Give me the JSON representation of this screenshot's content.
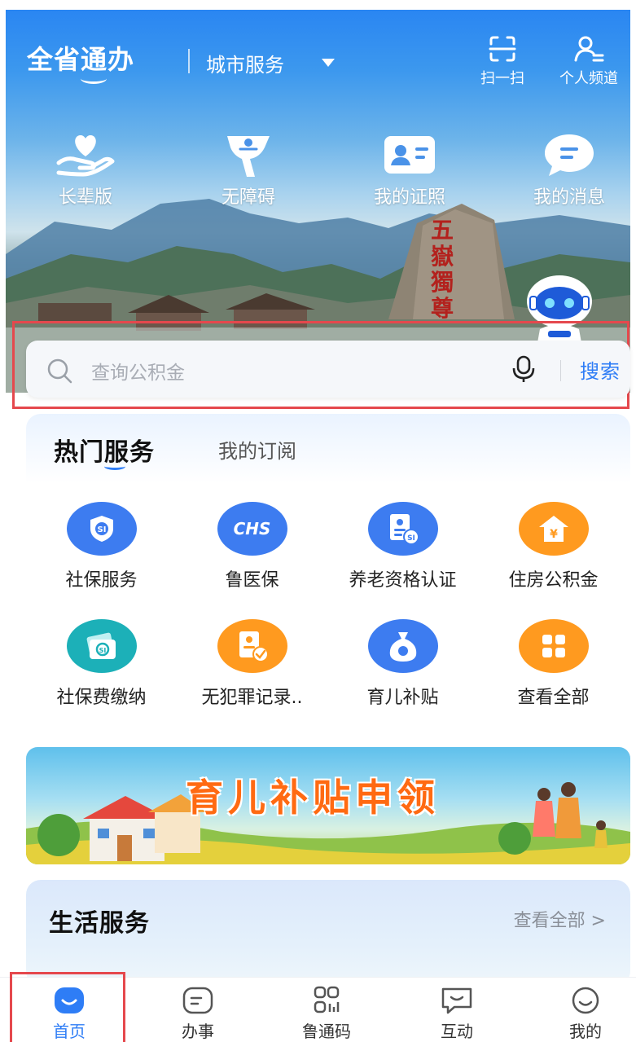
{
  "header": {
    "brand": "全省通办",
    "city_selector": "城市服务",
    "scan_label": "扫一扫",
    "personal_label": "个人频道"
  },
  "quick_actions": [
    {
      "label": "长辈版",
      "icon": "heart-hand-icon"
    },
    {
      "label": "无障碍",
      "icon": "accessibility-icon"
    },
    {
      "label": "我的证照",
      "icon": "id-card-icon"
    },
    {
      "label": "我的消息",
      "icon": "message-bubble-icon"
    }
  ],
  "search": {
    "placeholder": "查询公积金",
    "button": "搜索"
  },
  "hot_services": {
    "tab_active": "热门服务",
    "tab_other": "我的订阅",
    "items": [
      {
        "label": "社保服务",
        "icon": "social-security-icon",
        "color": "#3d7cf0"
      },
      {
        "label": "鲁医保",
        "icon": "chs-icon",
        "color": "#3d7cf0",
        "badge": "CHS"
      },
      {
        "label": "养老资格认证",
        "icon": "pension-cert-icon",
        "color": "#3d7cf0"
      },
      {
        "label": "住房公积金",
        "icon": "housing-fund-icon",
        "color": "#ff9a1f"
      },
      {
        "label": "社保费缴纳",
        "icon": "payment-card-icon",
        "color": "#1cb0b8"
      },
      {
        "label": "无犯罪记录..",
        "icon": "certificate-icon",
        "color": "#ff9a1f"
      },
      {
        "label": "育儿补贴",
        "icon": "money-bag-icon",
        "color": "#3d7cf0"
      },
      {
        "label": "查看全部",
        "icon": "grid-icon",
        "color": "#ff9a1f"
      }
    ]
  },
  "banner": {
    "title": "育儿补贴申领"
  },
  "life_services": {
    "title": "生活服务",
    "more": "查看全部 >"
  },
  "tabbar": [
    {
      "label": "首页",
      "active": true
    },
    {
      "label": "办事",
      "active": false
    },
    {
      "label": "鲁通码",
      "active": false
    },
    {
      "label": "互动",
      "active": false
    },
    {
      "label": "我的",
      "active": false
    }
  ],
  "colors": {
    "accent": "#2e7df6",
    "highlight_frame": "#e5484d",
    "orange": "#ff9a1f"
  }
}
